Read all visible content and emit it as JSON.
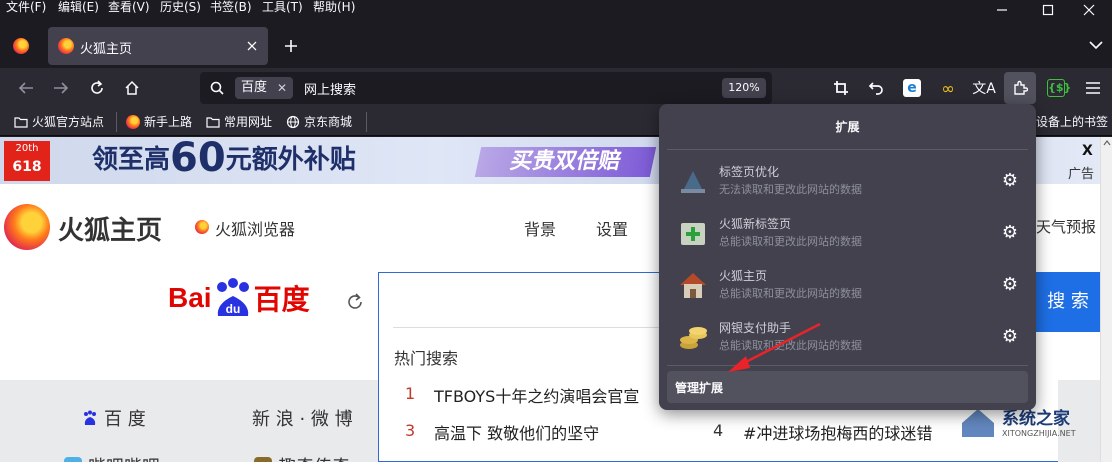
{
  "menubar": {
    "items": [
      "文件(F)",
      "编辑(E)",
      "查看(V)",
      "历史(S)",
      "书签(B)",
      "工具(T)",
      "帮助(H)"
    ]
  },
  "tabs": [
    {
      "title": "火狐主页"
    }
  ],
  "nav": {
    "search_engine": "百度",
    "url_placeholder": "网上搜索",
    "zoom": "120%"
  },
  "bookmarks": {
    "items": [
      "火狐官方站点",
      "新手上路",
      "常用网址",
      "京东商城"
    ],
    "overflow_tail": "设备上的书签"
  },
  "page": {
    "banner": {
      "badge_top": "20th",
      "badge_bottom": "618",
      "headline_a": "领至高",
      "headline_num": "60",
      "headline_b": "元额外补贴",
      "promo": "买贵双倍赔",
      "close": "X",
      "ad": "广告"
    },
    "site_logo": "火狐主页",
    "browser_link": "火狐浏览器",
    "nav_links": [
      "背景",
      "设置"
    ],
    "weather": "天气预报",
    "baidu_logo": "百度",
    "search_button": "搜 索",
    "hot_title": "热门搜索",
    "hot_items": [
      {
        "rank": "1",
        "text": "TFBOYS十年之约演唱会官宣"
      },
      {
        "rank": "3",
        "text": "高温下 致敬他们的坚守"
      },
      {
        "rank": "4",
        "text": "#冲进球场抱梅西的球迷错"
      }
    ],
    "quick_links": [
      "百 度",
      "新 浪 · 微 博"
    ],
    "bottom_links": [
      "哔哩哔哩",
      "趣奇传奇"
    ],
    "watermark": "系统之家",
    "watermark_url": "XITONGZHIJIA.NET"
  },
  "extensions_panel": {
    "title": "扩展",
    "items": [
      {
        "name": "标签页优化",
        "desc": "无法读取和更改此网站的数据",
        "icon": "tab-optimize-icon"
      },
      {
        "name": "火狐新标签页",
        "desc": "总能读取和更改此网站的数据",
        "icon": "new-tab-icon"
      },
      {
        "name": "火狐主页",
        "desc": "总能读取和更改此网站的数据",
        "icon": "home-house-icon"
      },
      {
        "name": "网银支付助手",
        "desc": "总能读取和更改此网站的数据",
        "icon": "coins-icon"
      }
    ],
    "manage_label": "管理扩展"
  },
  "colors": {
    "chrome_dark": "#1c1b22",
    "toolbar": "#2b2a33",
    "panel": "#42414d",
    "baidu_blue": "#2932e1",
    "baidu_red": "#e10602",
    "search_button": "#1e6fe6",
    "arrow_red": "#e8242a"
  }
}
